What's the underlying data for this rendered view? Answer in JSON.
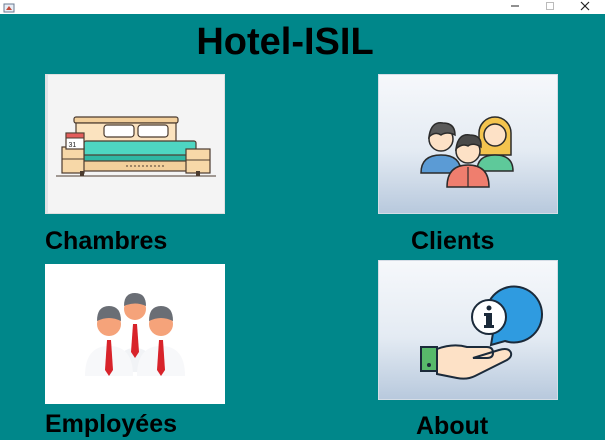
{
  "window": {
    "minimize_glyph": "—",
    "maximize_glyph": "□",
    "close_glyph": "✕"
  },
  "app": {
    "title": "Hotel-ISIL"
  },
  "menu": [
    {
      "label": "Chambres",
      "icon": "bed-icon"
    },
    {
      "label": "Clients",
      "icon": "clients-group-icon"
    },
    {
      "label": "Employées",
      "icon": "employees-group-icon"
    },
    {
      "label": "About",
      "icon": "info-hand-icon"
    }
  ],
  "colors": {
    "background": "#00878a",
    "text": "#000000"
  }
}
